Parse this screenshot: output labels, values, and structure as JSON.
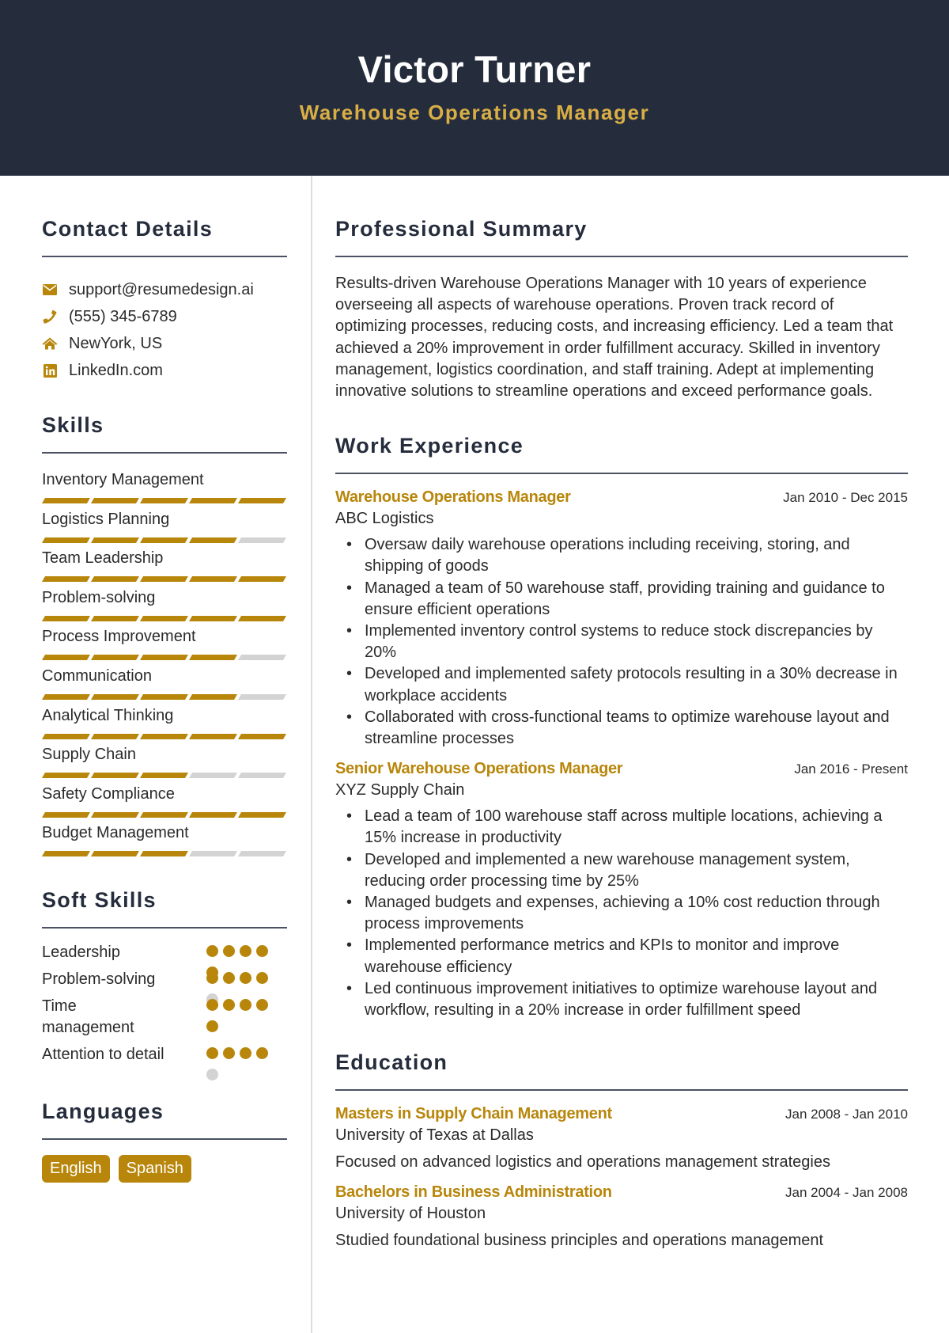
{
  "header": {
    "name": "Victor Turner",
    "title": "Warehouse Operations Manager"
  },
  "colors": {
    "header_bg": "#252d3d",
    "accent": "#b8860b",
    "title_gold": "#d9ae45",
    "inactive": "#d3d3d3"
  },
  "contact": {
    "heading": "Contact Details",
    "items": [
      {
        "icon": "envelope-icon",
        "text": "support@resumedesign.ai"
      },
      {
        "icon": "phone-icon",
        "text": "(555) 345-6789"
      },
      {
        "icon": "home-icon",
        "text": "NewYork, US"
      },
      {
        "icon": "linkedin-icon",
        "text": "LinkedIn.com"
      }
    ]
  },
  "skills": {
    "heading": "Skills",
    "max": 5,
    "items": [
      {
        "label": "Inventory Management",
        "level": 5
      },
      {
        "label": "Logistics Planning",
        "level": 4
      },
      {
        "label": "Team Leadership",
        "level": 5
      },
      {
        "label": "Problem-solving",
        "level": 5
      },
      {
        "label": "Process Improvement",
        "level": 4
      },
      {
        "label": "Communication",
        "level": 4
      },
      {
        "label": "Analytical Thinking",
        "level": 5
      },
      {
        "label": "Supply Chain",
        "level": 3
      },
      {
        "label": "Safety Compliance",
        "level": 5
      },
      {
        "label": "Budget Management",
        "level": 3
      }
    ]
  },
  "soft_skills": {
    "heading": "Soft Skills",
    "max": 5,
    "items": [
      {
        "label": "Leadership",
        "level": 5
      },
      {
        "label": "Problem-solving",
        "level": 4
      },
      {
        "label": "Time management",
        "level": 5
      },
      {
        "label": "Attention to detail",
        "level": 4
      }
    ]
  },
  "languages": {
    "heading": "Languages",
    "items": [
      "English",
      "Spanish"
    ]
  },
  "summary": {
    "heading": "Professional Summary",
    "text": "Results-driven Warehouse Operations Manager with 10 years of experience overseeing all aspects of warehouse operations. Proven track record of optimizing processes, reducing costs, and increasing efficiency. Led a team that achieved a 20% improvement in order fulfillment accuracy. Skilled in inventory management, logistics coordination, and staff training. Adept at implementing innovative solutions to streamline operations and exceed performance goals."
  },
  "experience": {
    "heading": "Work Experience",
    "jobs": [
      {
        "title": "Warehouse Operations Manager",
        "dates": "Jan 2010 - Dec 2015",
        "company": "ABC Logistics",
        "bullets": [
          "Oversaw daily warehouse operations including receiving, storing, and shipping of goods",
          "Managed a team of 50 warehouse staff, providing training and guidance to ensure efficient operations",
          "Implemented inventory control systems to reduce stock discrepancies by 20%",
          "Developed and implemented safety protocols resulting in a 30% decrease in workplace accidents",
          "Collaborated with cross-functional teams to optimize warehouse layout and streamline processes"
        ]
      },
      {
        "title": "Senior Warehouse Operations Manager",
        "dates": "Jan 2016 - Present",
        "company": "XYZ Supply Chain",
        "bullets": [
          "Lead a team of 100 warehouse staff across multiple locations, achieving a 15% increase in productivity",
          "Developed and implemented a new warehouse management system, reducing order processing time by 25%",
          "Managed budgets and expenses, achieving a 10% cost reduction through process improvements",
          "Implemented performance metrics and KPIs to monitor and improve warehouse efficiency",
          "Led continuous improvement initiatives to optimize warehouse layout and workflow, resulting in a 20% increase in order fulfillment speed"
        ]
      }
    ]
  },
  "education": {
    "heading": "Education",
    "items": [
      {
        "degree": "Masters in Supply Chain Management",
        "dates": "Jan 2008 - Jan 2010",
        "school": "University of Texas at Dallas",
        "description": "Focused on advanced logistics and operations management strategies"
      },
      {
        "degree": "Bachelors in Business Administration",
        "dates": "Jan 2004 - Jan 2008",
        "school": "University of Houston",
        "description": "Studied foundational business principles and operations management"
      }
    ]
  }
}
